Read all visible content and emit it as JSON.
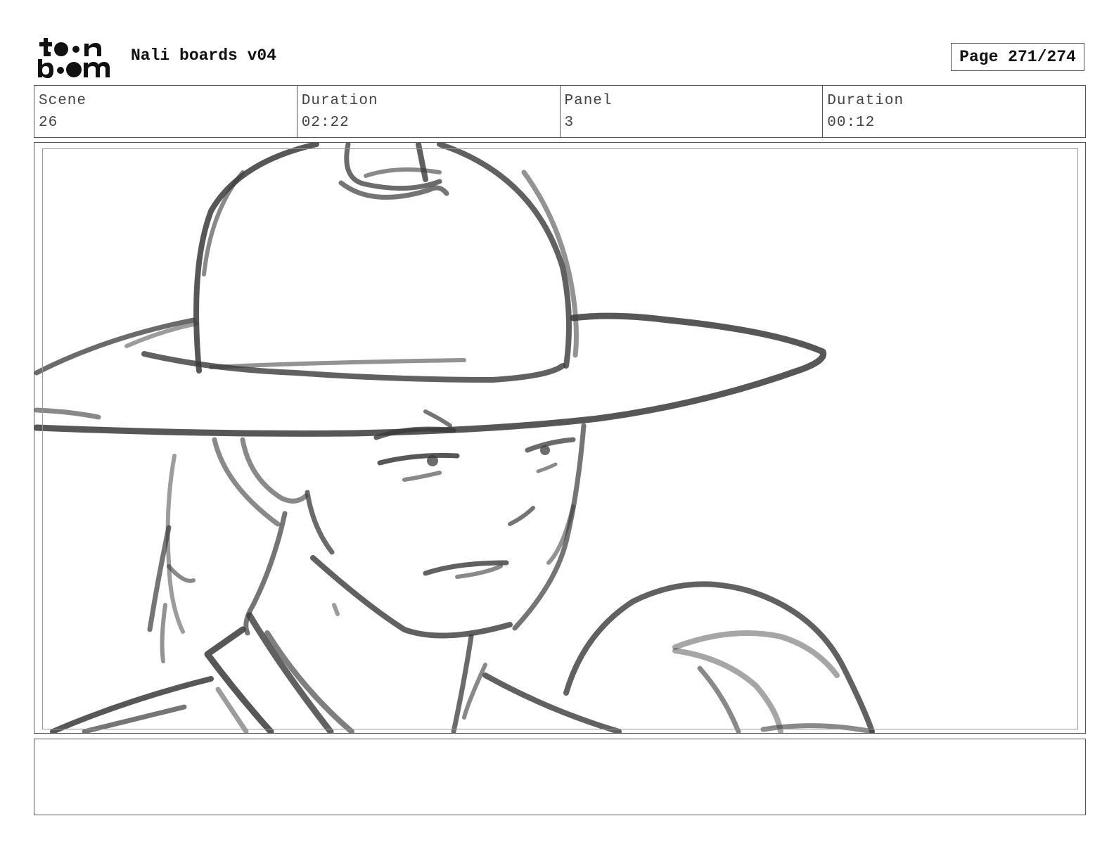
{
  "header": {
    "logo_text_top": "toon",
    "logo_text_bottom": "boom",
    "title": "Nali boards v04",
    "page": "Page 271/274"
  },
  "info": {
    "scene_label": "Scene",
    "scene_value": "26",
    "scene_duration_label": "Duration",
    "scene_duration_value": "02:22",
    "panel_label": "Panel",
    "panel_value": "3",
    "panel_duration_label": "Duration",
    "panel_duration_value": "00:12"
  },
  "panel": {
    "image": "storyboard-sketch-character-wide-brim-hat",
    "stroke_color": "#3a3a3a"
  },
  "notes": {
    "text": ""
  }
}
